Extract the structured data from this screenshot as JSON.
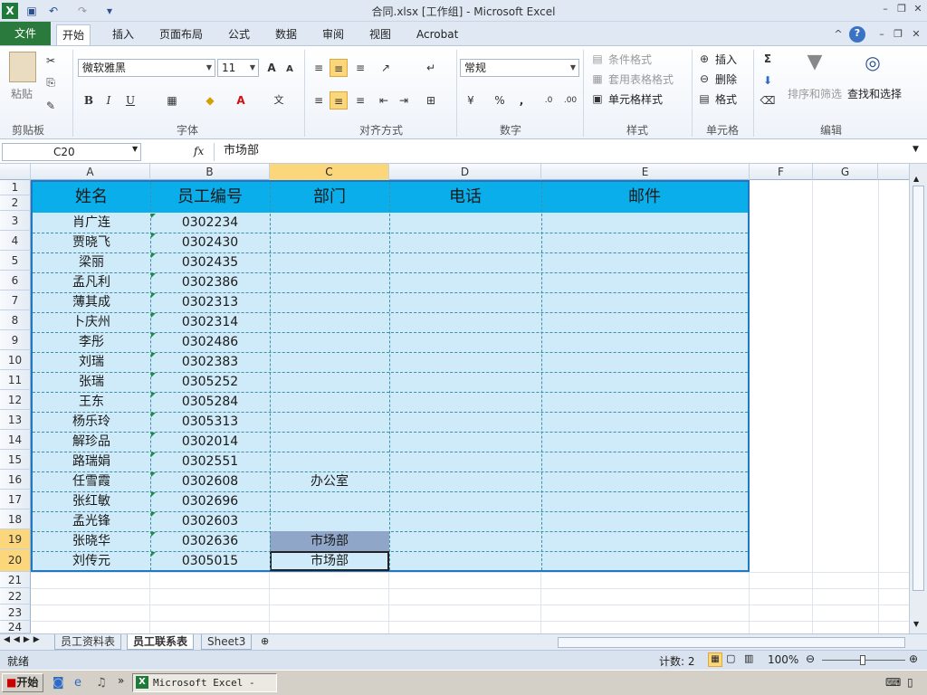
{
  "window": {
    "title": "合同.xlsx  [工作组]  -  Microsoft Excel"
  },
  "ribbon_tabs": [
    "文件",
    "开始",
    "插入",
    "页面布局",
    "公式",
    "数据",
    "审阅",
    "视图",
    "Acrobat"
  ],
  "ribbon": {
    "clipboard": {
      "paste": "粘贴",
      "label": "剪贴板"
    },
    "font": {
      "family": "微软雅黑",
      "size": "11",
      "label": "字体",
      "bold": "B",
      "italic": "I",
      "underline": "U"
    },
    "alignment": {
      "label": "对齐方式"
    },
    "number": {
      "format": "常规",
      "percent": "%",
      "comma": ",",
      "label": "数字"
    },
    "styles": {
      "conditional": "条件格式",
      "table": "套用表格格式",
      "cell": "单元格样式",
      "label": "样式"
    },
    "cells": {
      "insert": "插入",
      "delete": "删除",
      "format": "格式",
      "label": "单元格"
    },
    "editing": {
      "sum": "Σ",
      "sort": "排序和筛选",
      "find": "查找和选择",
      "label": "编辑"
    }
  },
  "formula_bar": {
    "name_box": "C20",
    "fx": "fx",
    "value": "市场部"
  },
  "columns": [
    "A",
    "B",
    "C",
    "D",
    "E",
    "F",
    "G"
  ],
  "selected_column": "C",
  "rows": [
    "1",
    "2",
    "3",
    "4",
    "5",
    "6",
    "7",
    "8",
    "9",
    "10",
    "11",
    "12",
    "13",
    "14",
    "15",
    "16",
    "17",
    "18",
    "19",
    "20",
    "21",
    "22",
    "23",
    "24"
  ],
  "selected_rows": [
    "19",
    "20"
  ],
  "table": {
    "headers": [
      "姓名",
      "员工编号",
      "部门",
      "电话",
      "邮件"
    ],
    "rows": [
      [
        "肖广连",
        "0302234",
        ""
      ],
      [
        "贾晓飞",
        "0302430",
        ""
      ],
      [
        "梁丽",
        "0302435",
        ""
      ],
      [
        "孟凡利",
        "0302386",
        ""
      ],
      [
        "薄其成",
        "0302313",
        ""
      ],
      [
        "卜庆州",
        "0302314",
        ""
      ],
      [
        "李彤",
        "0302486",
        ""
      ],
      [
        "刘瑞",
        "0302383",
        ""
      ],
      [
        "张瑞",
        "0305252",
        ""
      ],
      [
        "王东",
        "0305284",
        ""
      ],
      [
        "杨乐玲",
        "0305313",
        ""
      ],
      [
        "解珍品",
        "0302014",
        ""
      ],
      [
        "路瑞娟",
        "0302551",
        ""
      ],
      [
        "任雪霞",
        "0302608",
        "办公室"
      ],
      [
        "张红敏",
        "0302696",
        ""
      ],
      [
        "孟光锋",
        "0302603",
        ""
      ],
      [
        "张晓华",
        "0302636",
        "市场部"
      ],
      [
        "刘传元",
        "0305015",
        "市场部"
      ]
    ]
  },
  "sheet_tabs": [
    "员工资料表",
    "员工联系表",
    "Sheet3"
  ],
  "active_sheet": "员工联系表",
  "status": {
    "ready": "就绪",
    "count": "计数: 2",
    "zoom": "100%"
  },
  "taskbar": {
    "start": "开始",
    "app": "Microsoft Excel - ..."
  },
  "colors": {
    "header_fill": "#0aaeea",
    "body_fill": "#cfeaf8",
    "border": "#1f78c1",
    "file_tab": "#2b7a3d",
    "selection": "#fbd67a"
  }
}
